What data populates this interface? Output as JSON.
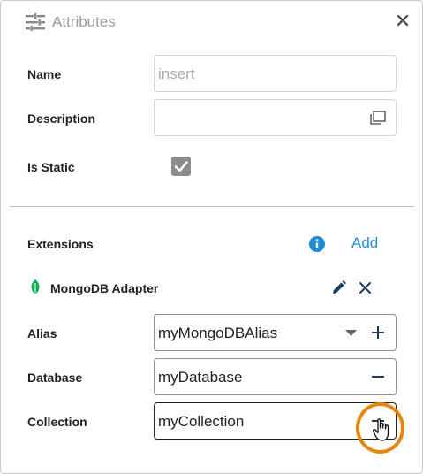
{
  "header": {
    "title": "Attributes",
    "icon": "sliders-icon",
    "close_icon": "close-icon"
  },
  "fields": {
    "name": {
      "label": "Name",
      "placeholder": "insert"
    },
    "description": {
      "label": "Description",
      "value": ""
    },
    "is_static": {
      "label": "Is Static",
      "checked": true
    }
  },
  "extensions": {
    "label": "Extensions",
    "add_label": "Add",
    "info_icon": "info-icon",
    "adapter": {
      "name": "MongoDB Adapter",
      "icon": "mongodb-leaf-icon",
      "alias": {
        "label": "Alias",
        "value": "myMongoDBAlias"
      },
      "database": {
        "label": "Database",
        "value": "myDatabase"
      },
      "collection": {
        "label": "Collection",
        "value": "myCollection"
      }
    }
  },
  "colors": {
    "accent": "#1f8bd8",
    "highlight": "#e8860c",
    "mongo_green": "#13aa52",
    "muted": "#9a9a9a"
  }
}
